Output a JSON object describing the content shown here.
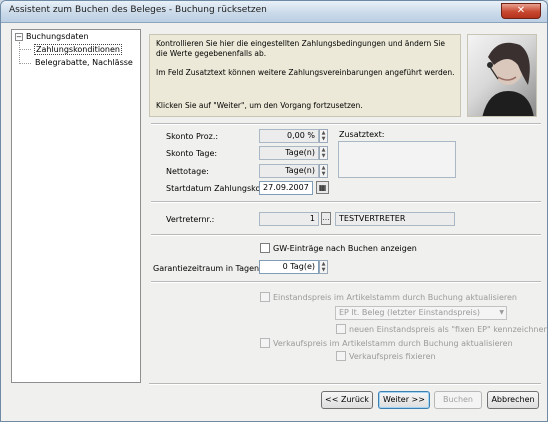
{
  "window": {
    "title": "Assistent zum Buchen des Beleges - Buchung rücksetzen"
  },
  "nav": {
    "root": "Buchungsdaten",
    "items": [
      {
        "label": "Zahlungskonditionen",
        "selected": true
      },
      {
        "label": "Belegrabatte, Nachlässe",
        "selected": false
      }
    ]
  },
  "info": {
    "line1": "Kontrollieren Sie hier die eingestellten Zahlungsbedingungen und ändern Sie",
    "line2": "die Werte gegebenenfalls ab.",
    "line3": "Im Feld Zusatztext können weitere Zahlungsvereinbarungen angeführt werden.",
    "line4": "Klicken Sie auf \"Weiter\", um den Vorgang fortzusetzen."
  },
  "payment": {
    "skonto_proz_label": "Skonto Proz.:",
    "skonto_proz_value": "0,00 %",
    "skonto_tage_label": "Skonto Tage:",
    "skonto_tage_value": "Tage(n)",
    "nettotage_label": "Nettotage:",
    "nettotage_value": "Tage(n)",
    "startdatum_label": "Startdatum Zahlungskond.:",
    "startdatum_value": "27.09.2007",
    "zusatztext_label": "Zusatztext:"
  },
  "vertreter": {
    "label": "Vertreternr.:",
    "number": "1",
    "name": "TESTVERTRETER"
  },
  "gw": {
    "checkbox_label": "GW-Einträge nach Buchen anzeigen",
    "garantie_label": "Garantiezeitraum in Tagen:",
    "garantie_value": "0 Tag(e)"
  },
  "prices": {
    "einstandspreis_label": "Einstandspreis im Artikelstamm durch Buchung aktualisieren",
    "ep_select": "EP lt. Beleg (letzter Einstandspreis)",
    "fixer_ep_label": "neuen Einstandspreis als \"fixen EP\" kennzeichnen",
    "verkaufspreis_label": "Verkaufspreis im Artikelstamm durch Buchung aktualisieren",
    "vp_fix_label": "Verkaufspreis fixieren"
  },
  "buttons": {
    "back": "<< Zurück",
    "next": "Weiter >>",
    "book": "Buchen",
    "cancel": "Abbrechen"
  }
}
